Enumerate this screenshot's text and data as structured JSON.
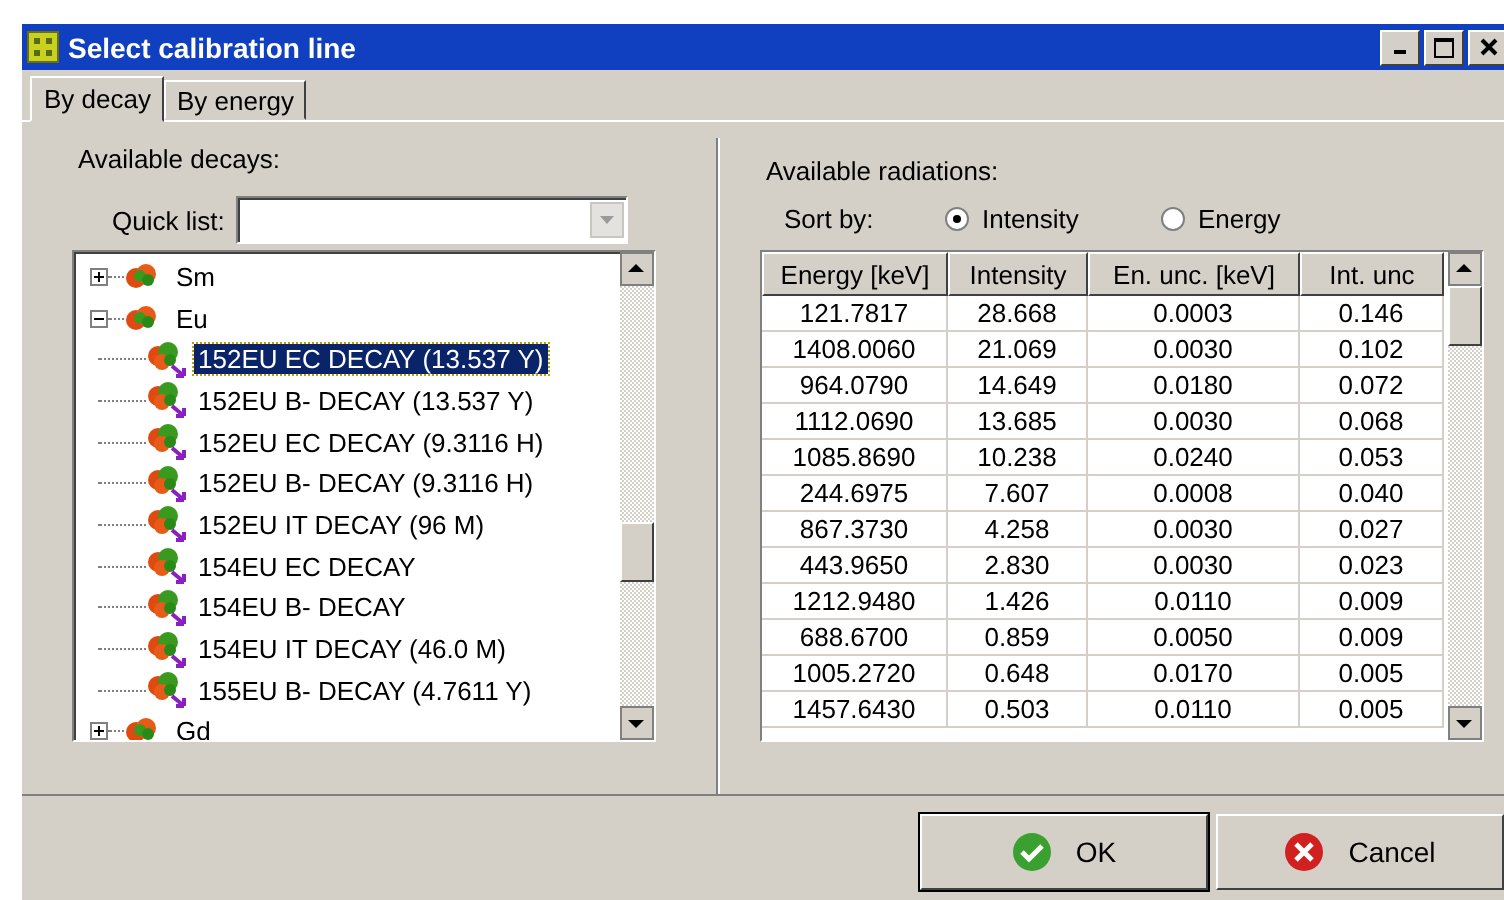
{
  "window": {
    "title": "Select calibration line"
  },
  "tabs": [
    {
      "label": "By decay",
      "selected": true
    },
    {
      "label": "By energy",
      "selected": false
    }
  ],
  "decays": {
    "label": "Available decays:",
    "quick_list": {
      "label": "Quick list:"
    },
    "tree": [
      {
        "kind": "element",
        "label": "Sm",
        "expanded": false
      },
      {
        "kind": "element",
        "label": "Eu",
        "expanded": true,
        "children": [
          {
            "kind": "decay",
            "label": "152EU EC DECAY (13.537 Y)",
            "selected": true
          },
          {
            "kind": "decay",
            "label": "152EU B- DECAY (13.537 Y)",
            "selected": false
          },
          {
            "kind": "decay",
            "label": "152EU EC DECAY (9.3116 H)",
            "selected": false
          },
          {
            "kind": "decay",
            "label": "152EU B- DECAY (9.3116 H)",
            "selected": false
          },
          {
            "kind": "decay",
            "label": "152EU IT DECAY (96 M)",
            "selected": false
          },
          {
            "kind": "decay",
            "label": "154EU EC DECAY",
            "selected": false
          },
          {
            "kind": "decay",
            "label": "154EU B- DECAY",
            "selected": false
          },
          {
            "kind": "decay",
            "label": "154EU IT DECAY (46.0 M)",
            "selected": false
          },
          {
            "kind": "decay",
            "label": "155EU B- DECAY (4.7611 Y)",
            "selected": false
          }
        ]
      },
      {
        "kind": "element",
        "label": "Gd",
        "expanded": false
      }
    ]
  },
  "radiations": {
    "label": "Available radiations:",
    "sort_label": "Sort by:",
    "sort_options": [
      {
        "label": "Intensity",
        "selected": true
      },
      {
        "label": "Energy",
        "selected": false
      }
    ],
    "table": {
      "columns": [
        "Energy [keV]",
        "Intensity",
        "En. unc. [keV]",
        "Int. unc"
      ],
      "rows": [
        [
          "121.7817",
          "28.668",
          "0.0003",
          "0.146"
        ],
        [
          "1408.0060",
          "21.069",
          "0.0030",
          "0.102"
        ],
        [
          "964.0790",
          "14.649",
          "0.0180",
          "0.072"
        ],
        [
          "1112.0690",
          "13.685",
          "0.0030",
          "0.068"
        ],
        [
          "1085.8690",
          "10.238",
          "0.0240",
          "0.053"
        ],
        [
          "244.6975",
          "7.607",
          "0.0008",
          "0.040"
        ],
        [
          "867.3730",
          "4.258",
          "0.0030",
          "0.027"
        ],
        [
          "443.9650",
          "2.830",
          "0.0030",
          "0.023"
        ],
        [
          "1212.9480",
          "1.426",
          "0.0110",
          "0.009"
        ],
        [
          "688.6700",
          "0.859",
          "0.0050",
          "0.009"
        ],
        [
          "1005.2720",
          "0.648",
          "0.0170",
          "0.005"
        ],
        [
          "1457.6430",
          "0.503",
          "0.0110",
          "0.005"
        ]
      ]
    }
  },
  "buttons": [
    {
      "kind": "ok",
      "label": "OK"
    },
    {
      "kind": "cancel",
      "label": "Cancel"
    }
  ]
}
